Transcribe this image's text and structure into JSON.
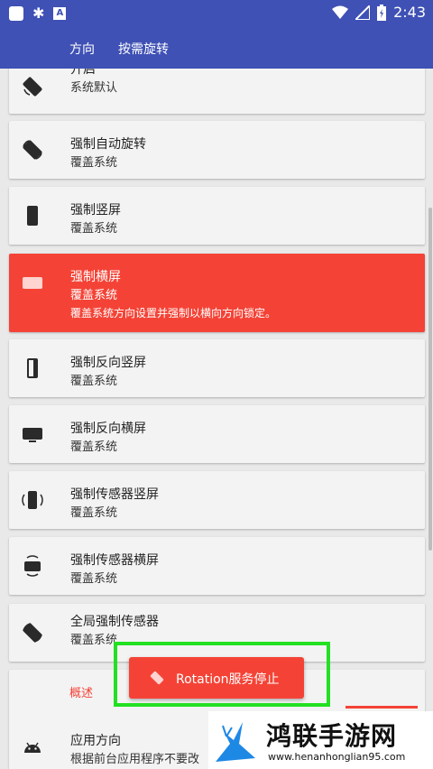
{
  "status_bar": {
    "time": "2:43",
    "notif_icon_letter": "A"
  },
  "toolbar": {
    "tabs": [
      "方向",
      "按需旋转"
    ]
  },
  "cards": [
    {
      "title": "开启",
      "subtitle": "系统默认",
      "icon": "rotate-default-icon"
    },
    {
      "title": "强制自动旋转",
      "subtitle": "覆盖系统",
      "icon": "auto-rotate-icon"
    },
    {
      "title": "强制竖屏",
      "subtitle": "覆盖系统",
      "icon": "portrait-icon"
    },
    {
      "title": "强制横屏",
      "subtitle": "覆盖系统",
      "description": "覆盖系统方向设置并强制以横向方向锁定。",
      "icon": "landscape-icon",
      "selected": true
    },
    {
      "title": "强制反向竖屏",
      "subtitle": "覆盖系统",
      "icon": "reverse-portrait-icon"
    },
    {
      "title": "强制反向横屏",
      "subtitle": "覆盖系统",
      "icon": "reverse-landscape-icon"
    },
    {
      "title": "强制传感器竖屏",
      "subtitle": "覆盖系统",
      "icon": "sensor-portrait-icon"
    },
    {
      "title": "强制传感器横屏",
      "subtitle": "覆盖系统",
      "icon": "sensor-landscape-icon"
    },
    {
      "title": "全局强制传感器",
      "subtitle": "覆盖系统",
      "icon": "global-sensor-icon"
    }
  ],
  "section": {
    "label": "概述"
  },
  "app_orientation": {
    "title": "应用方向",
    "subtitle": "根据前台应用程序不要改",
    "icon": "android-icon"
  },
  "toast": {
    "text": "Rotation服务停止",
    "icon": "rotation-icon"
  },
  "watermark": {
    "brand": "鸿联手游网",
    "url": "www.henanhonglian95.com"
  },
  "colors": {
    "primary": "#3f51b5",
    "accent": "#f44336",
    "highlight": "#22e022"
  }
}
